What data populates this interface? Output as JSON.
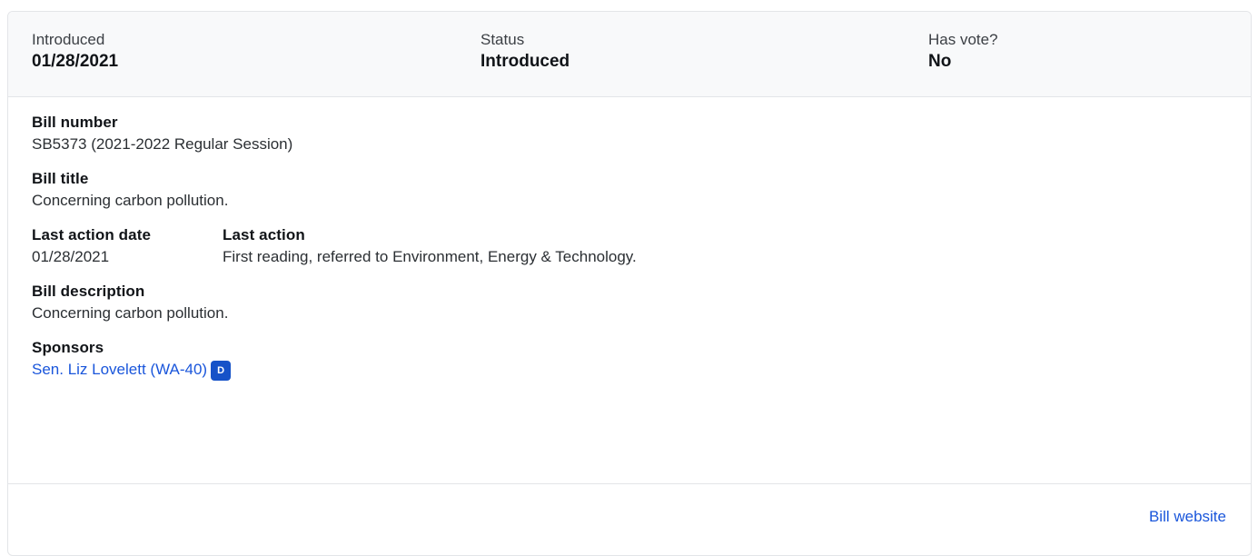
{
  "summary": {
    "introduced_label": "Introduced",
    "introduced_value": "01/28/2021",
    "status_label": "Status",
    "status_value": "Introduced",
    "has_vote_label": "Has vote?",
    "has_vote_value": "No"
  },
  "bill": {
    "number_label": "Bill number",
    "number_value": "SB5373 (2021-2022 Regular Session)",
    "title_label": "Bill title",
    "title_value": "Concerning carbon pollution.",
    "last_action_date_label": "Last action date",
    "last_action_date_value": "01/28/2021",
    "last_action_label": "Last action",
    "last_action_value": "First reading, referred to Environment, Energy & Technology.",
    "description_label": "Bill description",
    "description_value": "Concerning carbon pollution.",
    "sponsors_label": "Sponsors",
    "sponsors": [
      {
        "name": "Sen. Liz Lovelett (WA-40)",
        "party": "D"
      }
    ]
  },
  "footer": {
    "website_link": "Bill website"
  },
  "colors": {
    "link": "#1a56db",
    "party_democrat": "#1652c8"
  }
}
